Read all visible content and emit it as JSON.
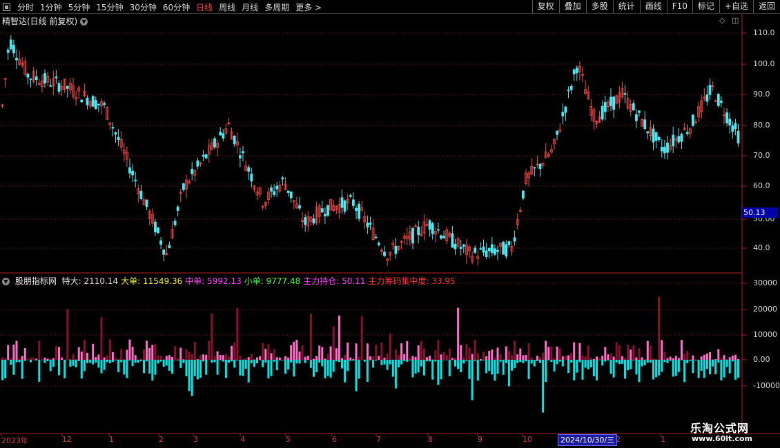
{
  "toolbar": {
    "periods": [
      "分时",
      "1分钟",
      "5分钟",
      "15分钟",
      "30分钟",
      "60分钟",
      "日线",
      "周线",
      "月线",
      "多周期",
      "更多 >"
    ],
    "active_period": "日线",
    "buttons": [
      "复权",
      "叠加",
      "多股",
      "统计",
      "画线",
      "F10",
      "标记",
      "+自选",
      "返回"
    ]
  },
  "main_pane": {
    "title": "精智达(日线 前复权)",
    "price_axis": [
      "110.0",
      "100.0",
      "90.0",
      "80.0",
      "70.0",
      "60.0",
      "50.00",
      "40.0"
    ],
    "current_price": "50.13"
  },
  "indicator_pane": {
    "name": "股朋指标网",
    "fields": [
      {
        "label": "特大: ",
        "value": "2110.14",
        "color": "#e0e0e0"
      },
      {
        "label": "大单: ",
        "value": "11549.36",
        "color": "#f0f030"
      },
      {
        "label": "中单: ",
        "value": "5992.13",
        "color": "#ff40ff"
      },
      {
        "label": "小单: ",
        "value": "9777.48",
        "color": "#40ff40"
      },
      {
        "label": "主力持仓: ",
        "value": "50.11",
        "color": "#ff40ff"
      },
      {
        "label": "主力筹码集中度: ",
        "value": "33.95",
        "color": "#ff3030"
      }
    ],
    "axis": [
      "30000",
      "20000",
      "10000",
      "0.00",
      "-10000"
    ]
  },
  "date_axis": {
    "labels": [
      "2023年",
      "12",
      "1",
      "2",
      "3",
      "4",
      "5",
      "6",
      "7",
      "8",
      "9",
      "10",
      "2",
      "1"
    ],
    "cursor_date": "2024/10/30/三"
  },
  "watermark": {
    "title": "乐淘公式网",
    "url": "www.60lt.com"
  },
  "colors": {
    "up": "#ff4a4a",
    "down": "#4fe8f0",
    "pos_bar": "#ff6ec8",
    "neg_bar": "#00e5e5",
    "grid": "#8a1a1a"
  }
}
